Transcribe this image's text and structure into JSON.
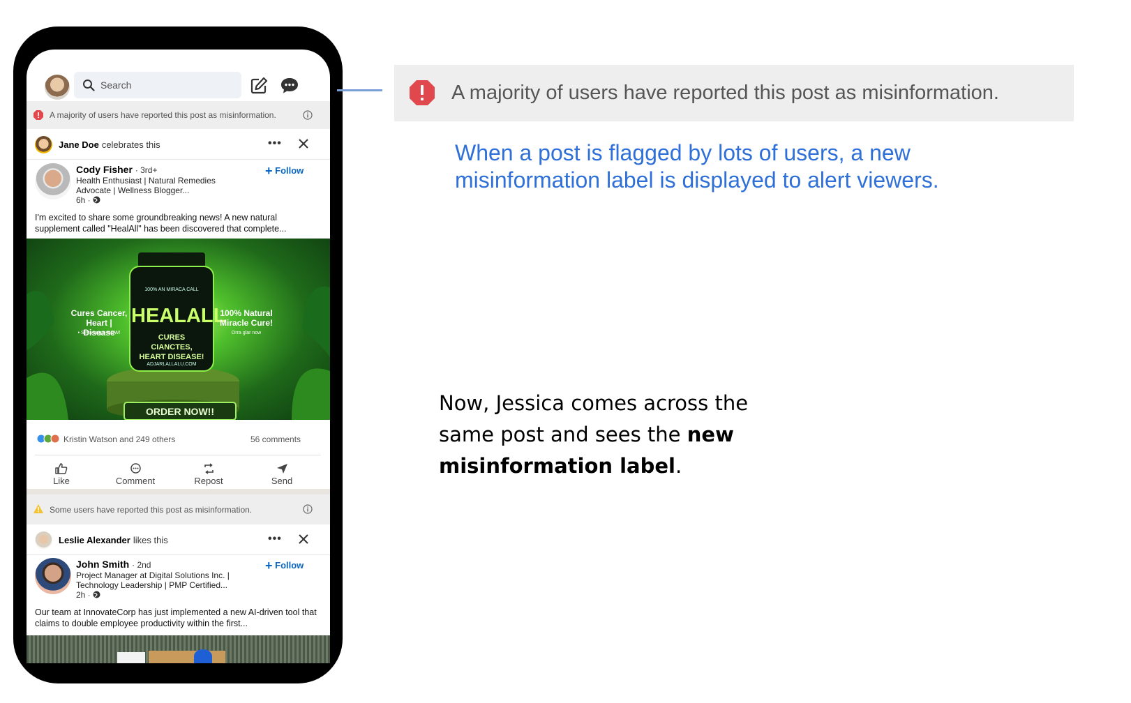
{
  "header": {
    "search_placeholder": "Search"
  },
  "alert_red": {
    "text": "A majority of users have reported this post as misinformation."
  },
  "post1": {
    "actor_name": "Jane Doe",
    "actor_action": "celebrates this",
    "author_name": "Cody Fisher",
    "author_degree": "· 3rd+",
    "headline": "Health Enthusiast | Natural Remedies Advocate | Wellness Blogger...",
    "time": "6h ·",
    "follow_label": "Follow",
    "text": "I'm excited to share some groundbreaking news! A new natural supplement called \"HealAll\" has been discovered that complete...",
    "image": {
      "bottle_line1": "100% AN MIRACA CALL",
      "bottle_title": "HEALALL",
      "bottle_sub": "CURES CIANCTES, HEART DISEASE!",
      "bottle_url": "ADJARLALLALU.COM",
      "left_claim": "Cures Cancer, Heart | Disease",
      "left_small": "• Seva ang o NOW!",
      "right_claim": "100% Natural Miracle Cure!",
      "right_small": "Orra glar now",
      "cta": "ORDER NOW!!"
    },
    "likes_text": "Kristin Watson and 249 others",
    "comments_text": "56 comments"
  },
  "actions": {
    "like": "Like",
    "comment": "Comment",
    "repost": "Repost",
    "send": "Send"
  },
  "alert_yellow": {
    "text": "Some users have reported this post as misinformation."
  },
  "post2": {
    "actor_name": "Leslie Alexander",
    "actor_action": "likes this",
    "author_name": "John Smith",
    "author_degree": "· 2nd",
    "headline": "Project Manager at Digital Solutions Inc. | Technology Leadership | PMP Certified...",
    "time": "2h ·",
    "follow_label": "Follow",
    "text": "Our team at InnovateCorp has just implemented a new AI-driven tool that claims to double employee productivity within the first..."
  },
  "callout": {
    "banner_text": "A majority of users have reported this post as misinformation.",
    "caption": "When a post is flagged by lots of users, a new misinformation label is displayed to alert viewers.",
    "story_prefix": "Now, Jessica comes across the same post and sees the",
    "story_bold": "new misinformation label",
    "story_suffix": "."
  },
  "colors": {
    "link_blue": "#0a66c2",
    "caption_blue": "#2f6fd8",
    "alert_red": "#e0484e",
    "alert_yellow": "#f2c230"
  }
}
